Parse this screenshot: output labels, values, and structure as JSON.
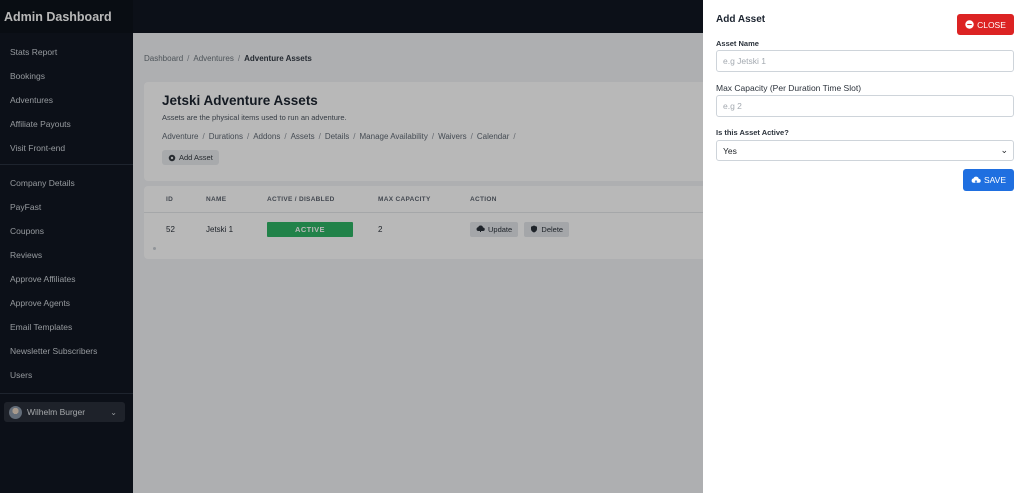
{
  "app": {
    "title": "Admin Dashboard"
  },
  "sidebar": {
    "group1": [
      "Stats Report",
      "Bookings",
      "Adventures",
      "Affiliate Payouts",
      "Visit Front-end"
    ],
    "group2": [
      "Company Details",
      "PayFast",
      "Coupons",
      "Reviews",
      "Approve Affiliates",
      "Approve Agents",
      "Email Templates",
      "Newsletter Subscribers",
      "Users"
    ],
    "user": {
      "name": "Wilhelm Burger",
      "icon": "chevron-down-icon"
    }
  },
  "breadcrumb": {
    "items": [
      "Dashboard",
      "Adventures"
    ],
    "current": "Adventure Assets"
  },
  "card": {
    "title": "Jetski Adventure Assets",
    "description": "Assets are the physical items used to run an adventure.",
    "tabs": [
      "Adventure",
      "Durations",
      "Addons",
      "Assets",
      "Details",
      "Manage Availability",
      "Waivers",
      "Calendar"
    ],
    "add_button": "Add Asset"
  },
  "table": {
    "headers": {
      "id": "ID",
      "name": "NAME",
      "active": "ACTIVE / DISABLED",
      "max": "MAX CAPACITY",
      "action": "ACTION"
    },
    "rows": [
      {
        "id": "52",
        "name": "Jetski 1",
        "status": "ACTIVE",
        "max": "2",
        "update_label": "Update",
        "delete_label": "Delete"
      }
    ]
  },
  "panel": {
    "title": "Add Asset",
    "close_label": "CLOSE",
    "asset_name": {
      "label": "Asset Name",
      "placeholder": "e.g Jetski 1",
      "value": ""
    },
    "max_capacity": {
      "label": "Max Capacity (Per Duration Time Slot)",
      "placeholder": "e.g 2",
      "value": ""
    },
    "active": {
      "label": "Is this Asset Active?",
      "value": "Yes"
    },
    "save_label": "SAVE"
  },
  "colors": {
    "sidebar": "#111722",
    "close": "#dc2323",
    "save": "#1f6fe0",
    "active_badge": "#2fb566"
  }
}
